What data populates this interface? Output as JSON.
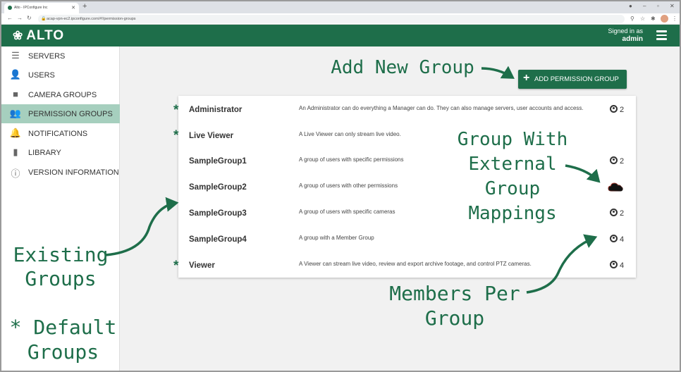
{
  "browser": {
    "tab_title": "Alto - IPConfigure Inc",
    "url": "acap-vpn-ec2.ipconfigure.com/#!/permission-groups"
  },
  "header": {
    "logo": "ALTO",
    "signed_in_label": "Signed in as",
    "user": "admin"
  },
  "sidebar": {
    "items": [
      {
        "label": "SERVERS",
        "icon": "servers-icon"
      },
      {
        "label": "USERS",
        "icon": "user-icon"
      },
      {
        "label": "CAMERA GROUPS",
        "icon": "camera-icon"
      },
      {
        "label": "PERMISSION GROUPS",
        "icon": "group-icon"
      },
      {
        "label": "NOTIFICATIONS",
        "icon": "bell-icon"
      },
      {
        "label": "LIBRARY",
        "icon": "bookmark-icon"
      },
      {
        "label": "VERSION INFORMATION",
        "icon": "info-icon"
      }
    ]
  },
  "main": {
    "add_button_label": "ADD PERMISSION GROUP",
    "groups": [
      {
        "name": "Administrator",
        "description": "An Administrator can do everything a Manager can do. They can also manage servers, user accounts and access.",
        "members": "2",
        "default": true
      },
      {
        "name": "Live Viewer",
        "description": "A Live Viewer can only stream live video.",
        "members": "",
        "default": true
      },
      {
        "name": "SampleGroup1",
        "description": "A group of users with specific permissions",
        "members": "2",
        "default": false
      },
      {
        "name": "SampleGroup2",
        "description": "A group of users with other permissions",
        "members": "",
        "external": true,
        "default": false
      },
      {
        "name": "SampleGroup3",
        "description": "A group of users with specific cameras",
        "members": "2",
        "default": false
      },
      {
        "name": "SampleGroup4",
        "description": "A group with a Member Group",
        "members": "4",
        "default": false
      },
      {
        "name": "Viewer",
        "description": "A Viewer can stream live video, review and export archive footage, and control PTZ cameras.",
        "members": "4",
        "default": true
      }
    ]
  },
  "annotations": {
    "add_new_group": "Add New Group",
    "external_l1": "Group With",
    "external_l2": "External",
    "external_l3": "Group",
    "external_l4": "Mappings",
    "existing_l1": "Existing",
    "existing_l2": "Groups",
    "members_l1": "Members Per",
    "members_l2": "Group",
    "default_l1": "* Default",
    "default_l2": "Groups",
    "star": "*"
  },
  "colors": {
    "brand": "#1e6e4a",
    "sidebar_active": "#a6cfbe"
  }
}
